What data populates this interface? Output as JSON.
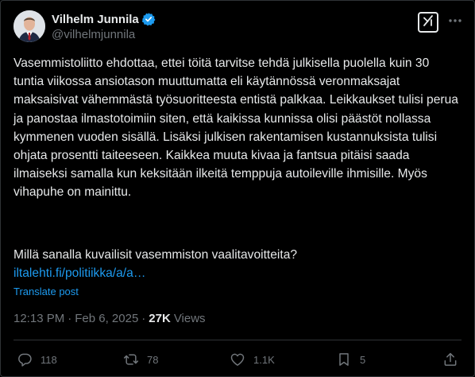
{
  "author": {
    "display_name": "Vilhelm Junnila",
    "handle": "@vilhelmjunnila",
    "verified": true
  },
  "header_icons": {
    "grok": "grok-icon",
    "more": "more-icon"
  },
  "tweet": {
    "text": "Vasemmistoliitto ehdottaa, ettei töitä tarvitse tehdä julkisella puolella kuin 30 tuntia viikossa ansiotason muuttumatta eli käytännössä veronmaksajat maksaisivat vähemmästä työsuoritteesta entistä palkkaa. Leikkaukset tulisi perua ja panostaa ilmastotoimiin siten, että kaikissa kunnissa olisi päästöt nollassa kymmenen vuoden sisällä. Lisäksi julkisen rakentamisen kustannuksista tulisi ohjata prosentti taiteeseen. Kaikkea muuta kivaa ja fantsua pitäisi saada ilmaiseksi samalla kun keksitään ilkeitä temppuja autoileville ihmisille. Myös vihapuhe on mainittu.",
    "question": "Millä sanalla kuvailisit vasemmiston vaalitavoitteita?",
    "link": "iltalehti.fi/politiikka/a/a…",
    "translate_label": "Translate post"
  },
  "meta": {
    "time": "12:13 PM",
    "separator": "·",
    "date": "Feb 6, 2025",
    "views_count": "27K",
    "views_label": "Views"
  },
  "actions": {
    "replies": "118",
    "reposts": "78",
    "likes": "1.1K",
    "bookmarks": "5"
  },
  "colors": {
    "background": "#000000",
    "text": "#e7e9ea",
    "secondary": "#71767b",
    "accent": "#1d9bf0",
    "border": "#2f3336"
  }
}
